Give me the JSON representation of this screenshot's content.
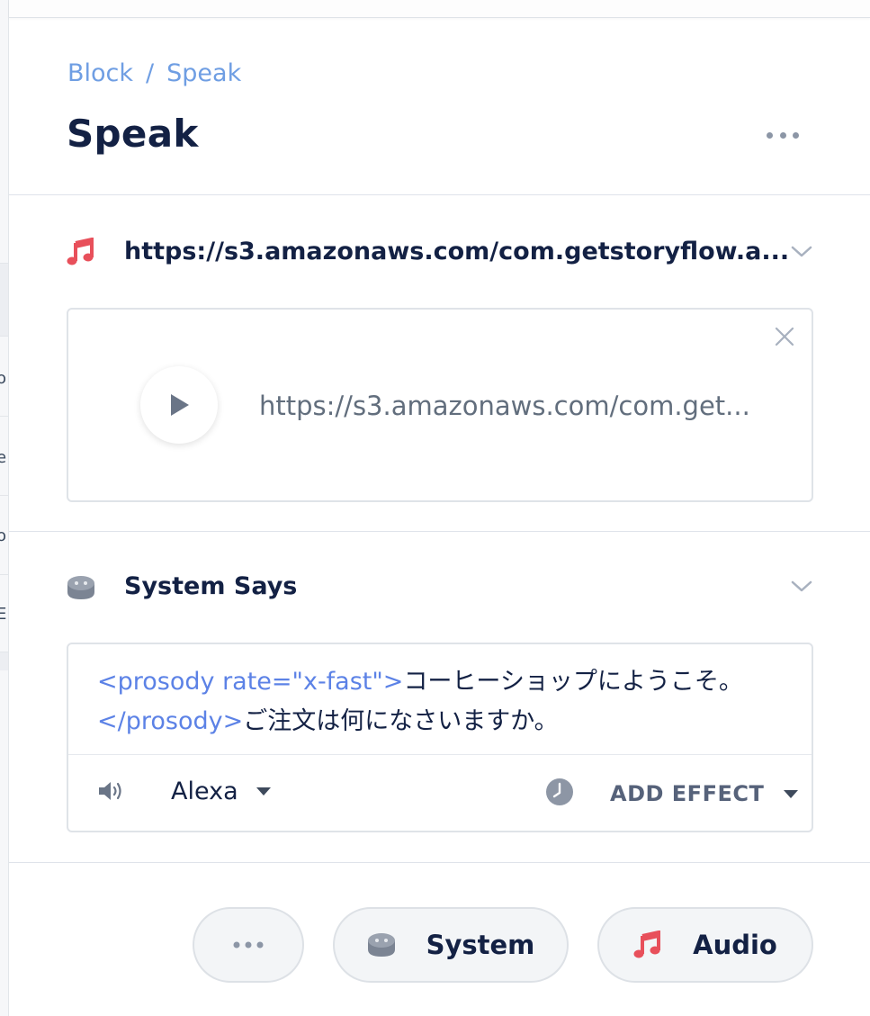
{
  "breadcrumb": {
    "parent": "Block",
    "separator": "/",
    "current": "Speak"
  },
  "header": {
    "title": "Speak",
    "more_icon": "more-horizontal-icon"
  },
  "audio_section": {
    "icon": "music-note-icon",
    "title": "https://s3.amazonaws.com/com.getstoryflow.a...",
    "expand_icon": "chevron-down-icon",
    "player": {
      "play_icon": "play-icon",
      "url": "https://s3.amazonaws.com/com.get...",
      "close_icon": "close-icon"
    }
  },
  "system_section": {
    "icon": "smart-speaker-icon",
    "title": "System Says",
    "expand_icon": "chevron-down-icon",
    "speech": {
      "line1_tag": "<prosody rate=\"x-fast\">",
      "line1_text": "コーヒーショップにようこそ。",
      "line2_tag": "</prosody>",
      "line2_text": "ご注文は何になさいますか。"
    },
    "voice": {
      "icon": "speaker-volume-icon",
      "value": "Alexa"
    },
    "effect": {
      "icon": "clock-icon",
      "label": "ADD EFFECT"
    }
  },
  "add_buttons": [
    {
      "label": "",
      "icon": "more-horizontal-icon"
    },
    {
      "label": "System",
      "icon": "smart-speaker-icon"
    },
    {
      "label": "Audio",
      "icon": "music-note-icon"
    }
  ],
  "left_strip": {
    "chars": [
      "o",
      "e",
      "o",
      "E"
    ]
  },
  "colors": {
    "accent_link": "#6f9ee3",
    "ssml_tag": "#5c82e6",
    "audio_icon": "#e8505b",
    "text_primary": "#132144",
    "muted": "#8c96a6"
  }
}
